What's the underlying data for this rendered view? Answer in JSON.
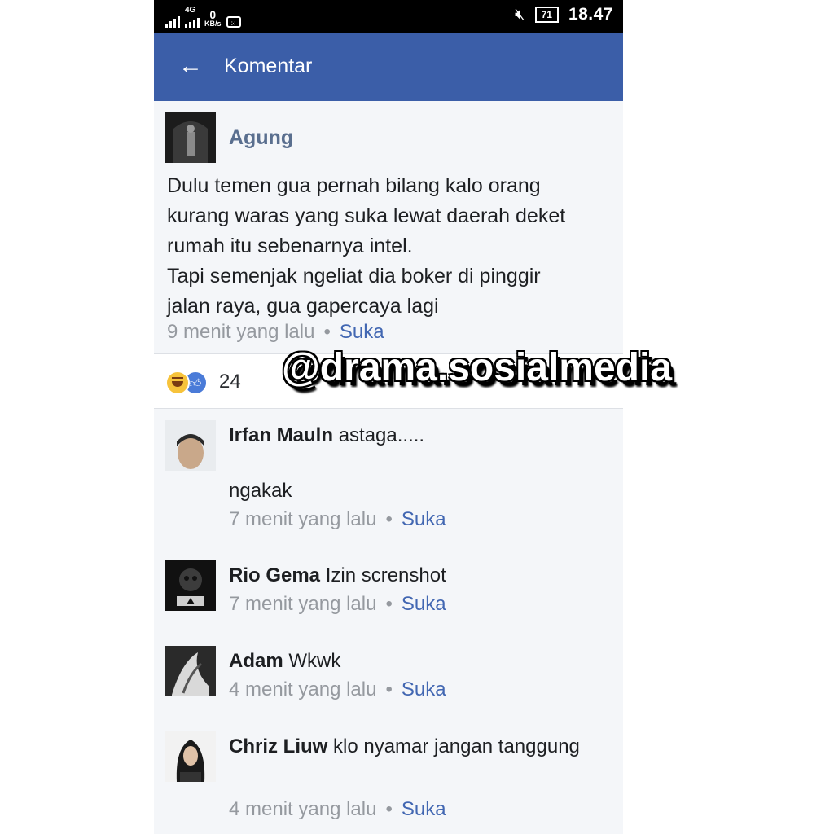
{
  "status_bar": {
    "network": "4G",
    "data_rate_value": "0",
    "data_rate_unit": "KB/s",
    "battery": "71",
    "time": "18.47"
  },
  "app_bar": {
    "title": "Komentar"
  },
  "post": {
    "author": "Agung",
    "lines": [
      "Dulu temen gua pernah bilang kalo orang",
      "kurang waras yang suka lewat daerah deket",
      "rumah itu sebenarnya intel.",
      "Tapi semenjak ngeliat dia boker di pinggir",
      "jalan raya, gua gapercaya lagi"
    ],
    "time": "9 menit yang lalu",
    "separator": "•",
    "like_label": "Suka"
  },
  "reactions": {
    "icons": [
      "haha-icon",
      "like-icon"
    ],
    "count": "24"
  },
  "watermark": "@drama.sosialmedia",
  "comments": [
    {
      "name": "Irfan Mauln",
      "text": "astaga.....",
      "extra": "ngakak",
      "time": "7 menit yang lalu",
      "like_label": "Suka"
    },
    {
      "name": "Rio Gema",
      "text": "Izin screnshot",
      "time": "7 menit yang lalu",
      "like_label": "Suka"
    },
    {
      "name": "Adam",
      "text": "Wkwk",
      "time": "4 menit yang lalu",
      "like_label": "Suka"
    },
    {
      "name": "Chriz Liuw",
      "text": "klo nyamar jangan tanggung",
      "time": "4 menit yang lalu",
      "like_label": "Suka"
    }
  ],
  "colors": {
    "app_bar": "#3b5ea8",
    "link": "#4267b2",
    "meta": "#95999f",
    "author": "#5a6f8f"
  }
}
